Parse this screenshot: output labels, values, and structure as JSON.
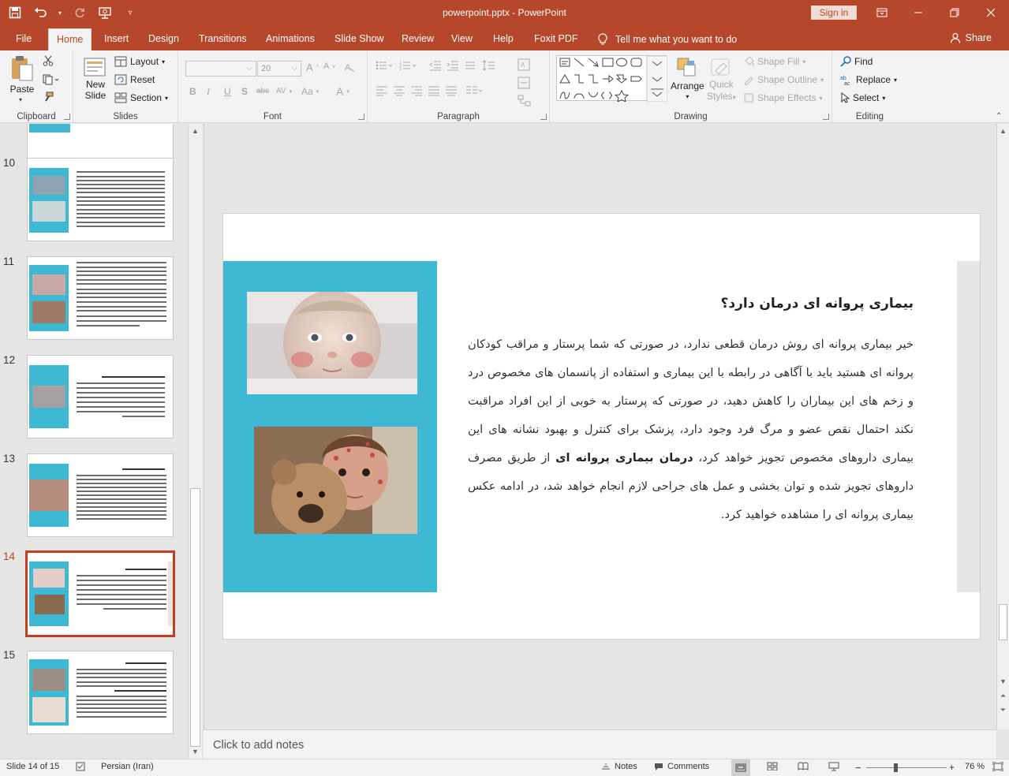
{
  "titlebar": {
    "title": "powerpoint.pptx  -  PowerPoint",
    "signin": "Sign in"
  },
  "tabs": [
    "File",
    "Home",
    "Insert",
    "Design",
    "Transitions",
    "Animations",
    "Slide Show",
    "Review",
    "View",
    "Help",
    "Foxit PDF"
  ],
  "active_tab": "Home",
  "tell_me": "Tell me what you want to do",
  "share": "Share",
  "ribbon": {
    "clipboard": {
      "label": "Clipboard",
      "paste": "Paste"
    },
    "slides": {
      "label": "Slides",
      "new_slide_1": "New",
      "new_slide_2": "Slide",
      "layout": "Layout",
      "reset": "Reset",
      "section": "Section"
    },
    "font": {
      "label": "Font",
      "size": "20"
    },
    "paragraph": {
      "label": "Paragraph"
    },
    "drawing": {
      "label": "Drawing",
      "arrange": "Arrange",
      "quick_styles_1": "Quick",
      "quick_styles_2": "Styles",
      "shape_fill": "Shape Fill",
      "shape_outline": "Shape Outline",
      "shape_effects": "Shape Effects"
    },
    "editing": {
      "label": "Editing",
      "find": "Find",
      "replace": "Replace",
      "select": "Select"
    }
  },
  "thumbnails": [
    {
      "num": "10"
    },
    {
      "num": "11"
    },
    {
      "num": "12"
    },
    {
      "num": "13"
    },
    {
      "num": "14"
    },
    {
      "num": "15"
    }
  ],
  "active_slide": "14",
  "slide": {
    "title": "بیماری پروانه ای درمان دارد؟",
    "body_part1": "خیر بیماری پروانه ای روش درمان قطعی ندارد، در صورتی که شما پرستار و مراقب کودکان پروانه ای هستید باید با آگاهی در رابطه با این بیماری و استفاده از پانسمان های مخصوص درد و زخم های این بیماران را کاهش دهید، در صورتی که پرستار به خوبی از این افراد مراقبت نکند احتمال نقص عضو و مرگ فرد وجود دارد، پزشک برای کنترل و بهبود نشانه های این بیماری داروهای مخصوص تجویز خواهد کرد، ",
    "body_bold": "درمان بیماری پروانه ای",
    "body_part2": " از طریق مصرف داروهای تجویز شده و توان بخشی و عمل های جراحی لازم انجام خواهد شد، در ادامه عکس بیماری پروانه ای را مشاهده خواهید کرد."
  },
  "notes_placeholder": "Click to add notes",
  "status": {
    "slide_of": "Slide 14 of 15",
    "language": "Persian (Iran)",
    "notes": "Notes",
    "comments": "Comments",
    "zoom": "76 %"
  },
  "colors": {
    "accent": "#b7472a",
    "slide_panel": "#3fb9d3",
    "active_thumb": "#c43e1c"
  }
}
